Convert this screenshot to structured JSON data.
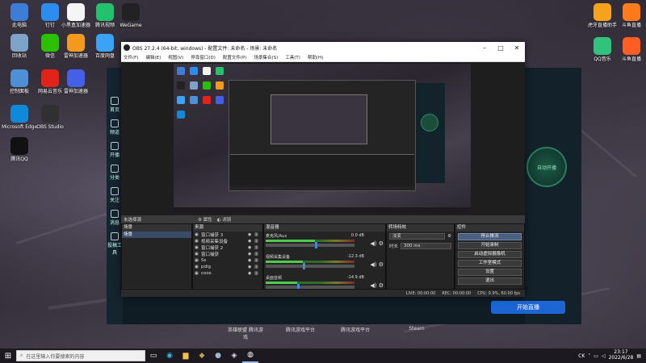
{
  "desktop": {
    "left_icons": [
      {
        "label": "此电脑",
        "icon": "computer-icon",
        "color": "#3d7dd8"
      },
      {
        "label": "钉钉",
        "icon": "dingtalk-icon",
        "color": "#2d8cf0"
      },
      {
        "label": "小黑盒加速器",
        "icon": "xiaoheihe-icon",
        "color": "#f5f5f5"
      },
      {
        "label": "腾讯视频",
        "icon": "tencent-video-icon",
        "color": "#21c26b"
      },
      {
        "label": "WeGame",
        "icon": "wegame-icon",
        "color": "#222222"
      },
      {
        "label": "回收站",
        "icon": "recycle-bin-icon",
        "color": "#7da3c9"
      },
      {
        "label": "微信",
        "icon": "wechat-icon",
        "color": "#2cc100"
      },
      {
        "label": "雷神加速器",
        "icon": "leishen-icon",
        "color": "#f39a1e"
      },
      {
        "label": "百度网盘",
        "icon": "baidu-netdisk-icon",
        "color": "#3aa3f5"
      },
      {
        "label": "控制面板",
        "icon": "control-panel-icon",
        "color": "#4e8fd8"
      },
      {
        "label": "网易云音乐",
        "icon": "netease-music-icon",
        "color": "#e2231a"
      },
      {
        "label": "雷神加速器",
        "icon": "thunder-icon",
        "color": "#4460e8"
      },
      {
        "label": "Microsoft Edge",
        "icon": "edge-icon",
        "color": "#0f8ad8"
      },
      {
        "label": "OBS Studio",
        "icon": "obs-icon",
        "color": "#303030"
      },
      {
        "label": "腾讯QQ",
        "icon": "qq-icon",
        "color": "#111111"
      }
    ],
    "right_icons": [
      {
        "label": "虎牙直播助手",
        "icon": "huya-icon",
        "color": "#f7a21b"
      },
      {
        "label": "斗鱼直播",
        "icon": "douyu-icon",
        "color": "#ff7a1a"
      },
      {
        "label": "QQ音乐",
        "icon": "qq-music-icon",
        "color": "#31c27c"
      },
      {
        "label": "斗鱼直播",
        "icon": "douyu2-icon",
        "color": "#ff5d23"
      }
    ],
    "bottom_labels": [
      "英雄联盟 腾讯游戏",
      "腾讯游戏平台",
      "腾讯游戏平台",
      "Steam"
    ]
  },
  "bg_app": {
    "side_items": [
      "首页",
      "频道",
      "开播",
      "分类",
      "关注",
      "消息",
      "投稿工具"
    ],
    "circle_text": "自动开播",
    "start_button": "开始直播"
  },
  "obs": {
    "title": "OBS 27.2.4 (64-bit, windows) - 配置文件: 未命名 - 场景: 未命名",
    "menu": [
      "文件(F)",
      "编辑(E)",
      "视图(V)",
      "停靠窗口(D)",
      "配置文件(P)",
      "场景集合(S)",
      "工具(T)",
      "帮助(H)"
    ],
    "no_source": "未选择源",
    "props_tab": "属性",
    "filters_tab": "滤镜",
    "scenes": {
      "header": "场景",
      "items": [
        "场景"
      ]
    },
    "sources": {
      "header": "来源",
      "items": [
        "窗口捕获 3",
        "视频采集设备",
        "窗口捕获 2",
        "窗口捕获",
        "Ss",
        "pdig",
        "coos"
      ]
    },
    "mixer": {
      "header": "混音器",
      "channels": [
        {
          "name": "麦克风/Aux",
          "db": "0.0 dB",
          "level": 0.55
        },
        {
          "name": "视频采集设备",
          "db": "-12.3 dB",
          "level": 0.42
        },
        {
          "name": "桌面音频",
          "db": "-14.9 dB",
          "level": 0.35
        }
      ]
    },
    "transitions": {
      "header": "转场特效",
      "type": "淡变",
      "duration_label": "时长",
      "duration": "300 ms"
    },
    "controls": {
      "header": "控件",
      "buttons": [
        "停止推流",
        "开始录制",
        "启动虚拟摄像机",
        "工作室模式",
        "设置",
        "退出"
      ]
    },
    "status": [
      "LIVE: 00:00:00",
      "REC: 00:00:00",
      "CPU: 0.9%, 60.00 fps"
    ]
  },
  "taskbar": {
    "search_placeholder": "在这里输入你要搜索的内容",
    "tray_text": "CK",
    "time": "23:17",
    "date": "2022/6/28"
  }
}
